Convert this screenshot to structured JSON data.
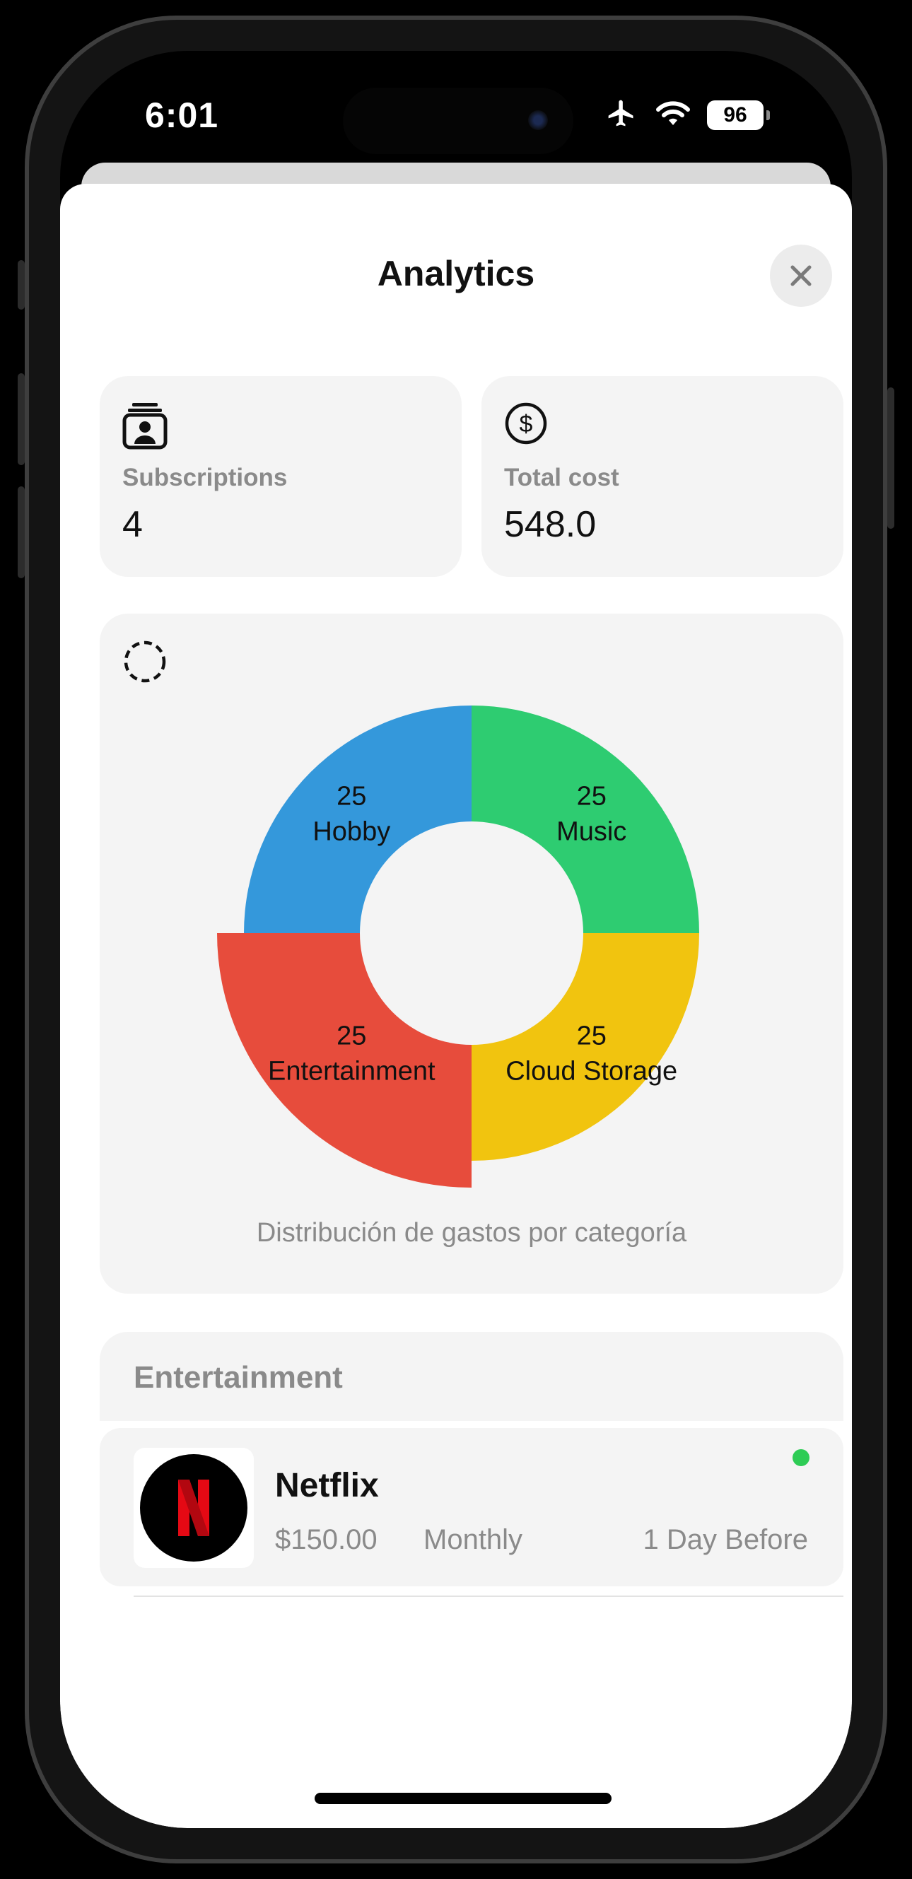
{
  "status_bar": {
    "time": "6:01",
    "battery": "96",
    "icons": [
      "airplane-icon",
      "wifi-icon",
      "battery-icon"
    ]
  },
  "sheet": {
    "title": "Analytics",
    "close_icon": "close-icon"
  },
  "stats": {
    "subscriptions": {
      "label": "Subscriptions",
      "value": "4",
      "icon": "contacts-stack-icon"
    },
    "total_cost": {
      "label": "Total cost",
      "value": "548.0",
      "icon": "dollar-circle-icon"
    }
  },
  "chart_card": {
    "icon": "dashed-circle-icon",
    "caption": "Distribución de gastos por categoría"
  },
  "chart_data": {
    "type": "pie",
    "categories": [
      "Music",
      "Cloud Storage",
      "Entertainment",
      "Hobby"
    ],
    "values": [
      25,
      25,
      25,
      25
    ],
    "colors": [
      "#2ecc71",
      "#f1c40f",
      "#e74c3c",
      "#3498db"
    ],
    "highlighted": "Entertainment",
    "title": "Distribución de gastos por categoría"
  },
  "section": {
    "header": "Entertainment",
    "items": [
      {
        "name": "Netflix",
        "price": "$150.00",
        "cycle": "Monthly",
        "due": "1 Day Before",
        "status_color": "#2ecc55",
        "logo_icon": "netflix-logo-icon"
      }
    ]
  },
  "colors": {
    "card_bg": "#f4f4f4",
    "secondary_text": "#8a8a8a",
    "primary_text": "#111111"
  }
}
